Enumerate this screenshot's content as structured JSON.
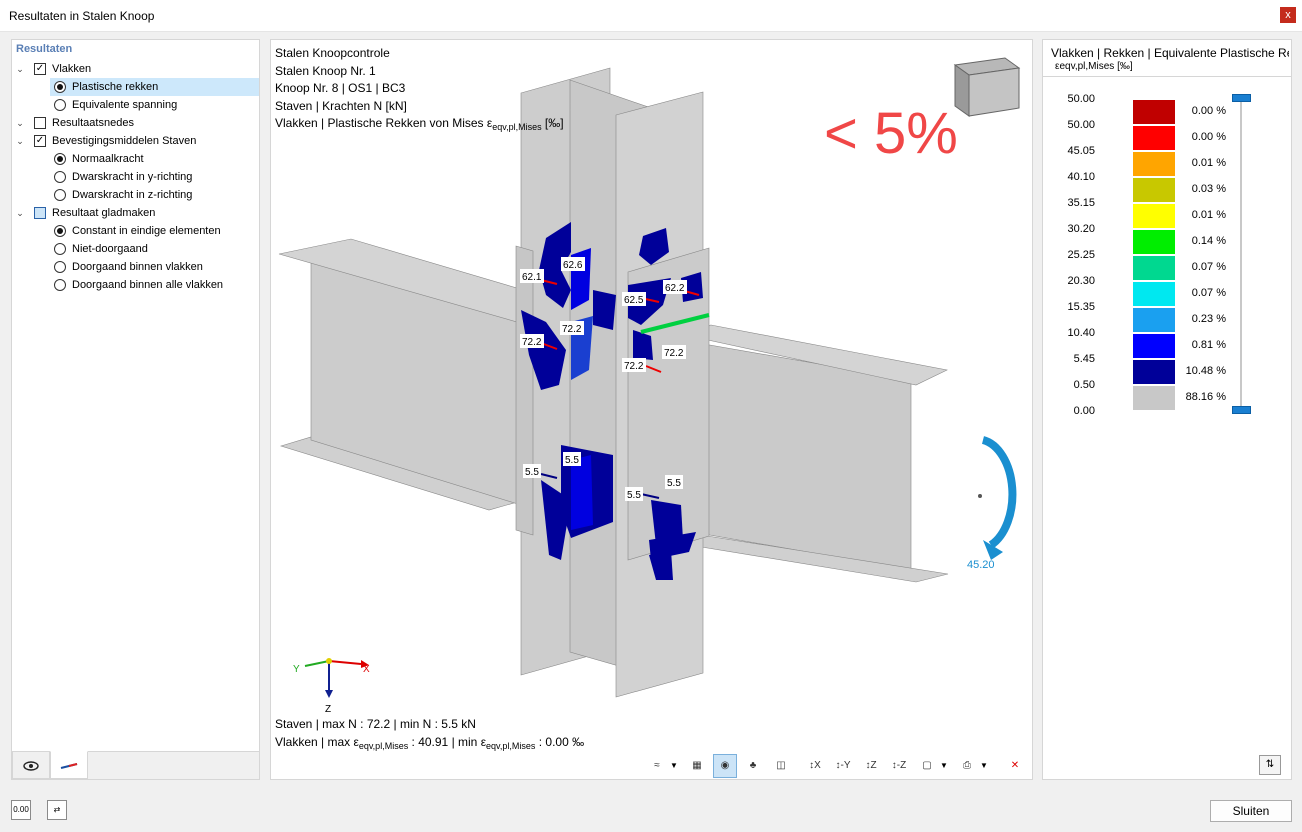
{
  "window": {
    "title": "Resultaten in Stalen Knoop",
    "close_glyph": "x"
  },
  "tree": {
    "header": "Resultaten",
    "items": [
      {
        "label": "Vlakken",
        "kind": "checkbox",
        "state": "checked",
        "level": 0,
        "expanded": true
      },
      {
        "label": "Plastische rekken",
        "kind": "radio",
        "state": "on",
        "level": 1,
        "selected": true
      },
      {
        "label": "Equivalente spanning",
        "kind": "radio",
        "state": "off",
        "level": 1
      },
      {
        "label": "Resultaatsnedes",
        "kind": "checkbox",
        "state": "unchecked",
        "level": 0
      },
      {
        "label": "Bevestigingsmiddelen Staven",
        "kind": "checkbox",
        "state": "checked",
        "level": 0,
        "expanded": true
      },
      {
        "label": "Normaalkracht",
        "kind": "radio",
        "state": "on",
        "level": 1
      },
      {
        "label": "Dwarskracht in y-richting",
        "kind": "radio",
        "state": "off",
        "level": 1
      },
      {
        "label": "Dwarskracht in z-richting",
        "kind": "radio",
        "state": "off",
        "level": 1
      },
      {
        "label": "Resultaat gladmaken",
        "kind": "checkbox",
        "state": "partial",
        "level": 0,
        "expanded": true
      },
      {
        "label": "Constant in eindige elementen",
        "kind": "radio",
        "state": "on",
        "level": 1
      },
      {
        "label": "Niet-doorgaand",
        "kind": "radio",
        "state": "off",
        "level": 1
      },
      {
        "label": "Doorgaand binnen vlakken",
        "kind": "radio",
        "state": "off",
        "level": 1
      },
      {
        "label": "Doorgaand binnen alle vlakken",
        "kind": "radio",
        "state": "off",
        "level": 1
      }
    ],
    "tabs": [
      {
        "name": "eye-tab",
        "icon": "eye-icon"
      },
      {
        "name": "member-tab",
        "icon": "member-icon"
      }
    ]
  },
  "viewport": {
    "info_lines": [
      "Stalen Knoopcontrole",
      "Stalen Knoop Nr. 1",
      "Knoop Nr. 8 | OS1 | BC3",
      "Staven | Krachten N [kN]"
    ],
    "info_line5_prefix": "Vlakken | Plastische Rekken von Mises ε",
    "info_line5_sub": "eqv,pl,Mises",
    "info_line5_suffix": " [‰]",
    "big_label": "< 5%",
    "value_labels": [
      "62.1",
      "62.6",
      "72.2",
      "72.2",
      "62.5",
      "62.2",
      "72.2",
      "72.2",
      "5.5",
      "5.5",
      "5.5",
      "5.5"
    ],
    "rotation_label": "45.20",
    "axes": {
      "y": "Y",
      "x": "X",
      "z": "Z"
    },
    "bottom_line1": "Staven | max N : 72.2 | min N : 5.5 kN",
    "bottom_line2_a": "Vlakken | max ε",
    "bottom_line2_sub1": "eqv,pl,Mises",
    "bottom_line2_b": " : 40.91 | min ε",
    "bottom_line2_sub2": "eqv,pl,Mises",
    "bottom_line2_c": " : 0.00 ‰",
    "toolbar": [
      {
        "name": "display-mode-button",
        "glyph": "≈",
        "dropdown": true
      },
      {
        "name": "grid-view-button",
        "glyph": "▦"
      },
      {
        "name": "results-view-button",
        "glyph": "◉",
        "pressed": true
      },
      {
        "name": "members-view-button",
        "glyph": "♣"
      },
      {
        "name": "section-view-button",
        "glyph": "◫"
      },
      {
        "name": "view-x-button",
        "glyph": "↕X"
      },
      {
        "name": "view-neg-y-button",
        "glyph": "↕-Y"
      },
      {
        "name": "view-z-button",
        "glyph": "↕Z"
      },
      {
        "name": "view-neg-z-button",
        "glyph": "↕-Z"
      },
      {
        "name": "iso-view-button",
        "glyph": "▢",
        "dropdown": true
      },
      {
        "name": "print-button",
        "glyph": "⎙",
        "dropdown": true
      },
      {
        "name": "reset-view-button",
        "glyph": "✕"
      }
    ]
  },
  "legend": {
    "title": "Vlakken | Rekken | Equivalente Plastische Rekken",
    "subtitle": "εeqv,pl,Mises [‰]",
    "values": [
      "50.00",
      "50.00",
      "45.05",
      "40.10",
      "35.15",
      "30.20",
      "25.25",
      "20.30",
      "15.35",
      "10.40",
      "5.45",
      "0.50",
      "0.00"
    ],
    "bands": [
      {
        "color": "#c00000",
        "pct": "0.00 %"
      },
      {
        "color": "#ff0000",
        "pct": "0.00 %"
      },
      {
        "color": "#ffa500",
        "pct": "0.01 %"
      },
      {
        "color": "#c8c800",
        "pct": "0.03 %"
      },
      {
        "color": "#ffff00",
        "pct": "0.01 %"
      },
      {
        "color": "#00ee00",
        "pct": "0.14 %"
      },
      {
        "color": "#00d890",
        "pct": "0.07 %"
      },
      {
        "color": "#00e8f0",
        "pct": "0.07 %"
      },
      {
        "color": "#1aa0f0",
        "pct": "0.23 %"
      },
      {
        "color": "#0000ff",
        "pct": "0.81 %"
      },
      {
        "color": "#000099",
        "pct": "10.48 %"
      },
      {
        "color": "#c8c8c8",
        "pct": "88.16 %"
      }
    ],
    "settings_glyph": "⇅"
  },
  "footer": {
    "close_label": "Sluiten",
    "icon1": "0.00",
    "icon2": "⇄"
  }
}
